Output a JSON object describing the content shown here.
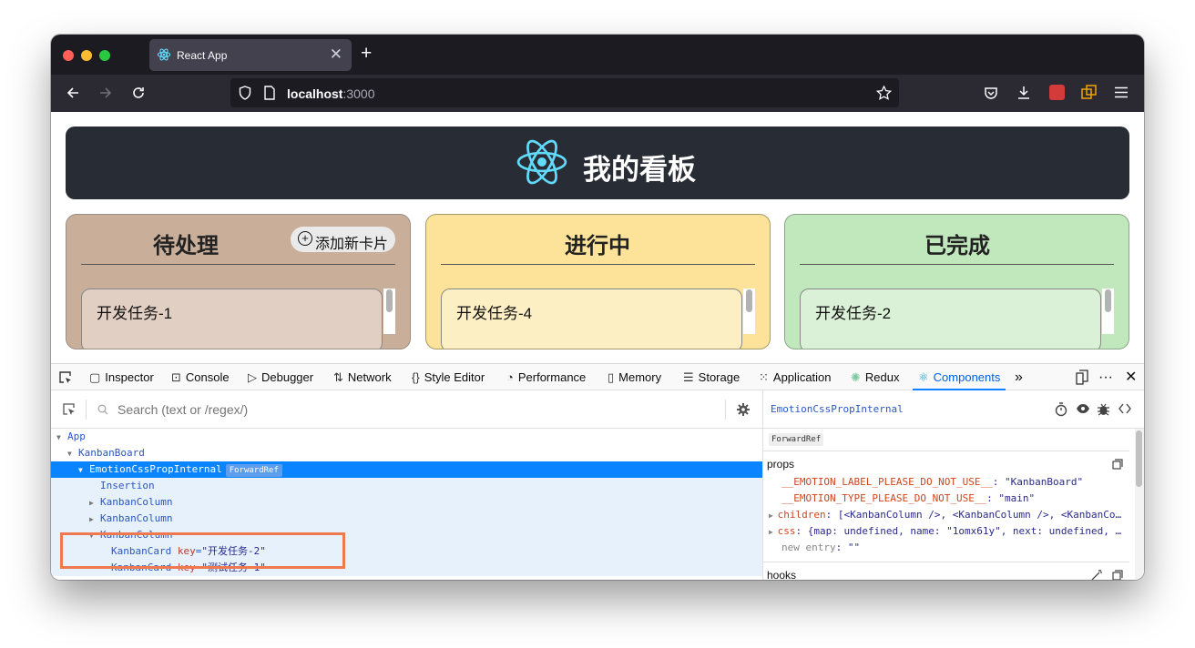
{
  "browser": {
    "tab_title": "React App",
    "tab_close": "✕",
    "new_tab": "+",
    "url_host": "localhost",
    "url_port": ":3000"
  },
  "app": {
    "title": "我的看板",
    "columns": [
      {
        "title": "待处理",
        "bg": "#c9af9a",
        "card_bg": "#e1cfc3",
        "add_label": "添加新卡片",
        "first_card": "开发任务-1"
      },
      {
        "title": "进行中",
        "bg": "#fde39a",
        "card_bg": "#fdefc4",
        "first_card": "开发任务-4"
      },
      {
        "title": "已完成",
        "bg": "#c1e7bc",
        "card_bg": "#dbf1d7",
        "first_card": "开发任务-2"
      }
    ]
  },
  "devtools": {
    "tabs": [
      "Inspector",
      "Console",
      "Debugger",
      "Network",
      "Style Editor",
      "Performance",
      "Memory",
      "Storage",
      "Application",
      "Redux",
      "Components"
    ],
    "active_tab": "Components",
    "search_placeholder": "Search (text or /regex/)",
    "tree": [
      {
        "name": "App"
      },
      {
        "name": "KanbanBoard"
      },
      {
        "name": "EmotionCssPropInternal",
        "badge": "ForwardRef"
      },
      {
        "name": "Insertion"
      },
      {
        "name": "KanbanColumn"
      },
      {
        "name": "KanbanColumn"
      },
      {
        "name": "KanbanColumn"
      },
      {
        "name": "KanbanCard",
        "key": "key",
        "value": "\"开发任务-2\""
      },
      {
        "name": "KanbanCard",
        "key": "key",
        "value": "\"测试任务-1\""
      }
    ],
    "inspector": {
      "component": "EmotionCssPropInternal",
      "badge": "ForwardRef",
      "props_label": "props",
      "hooks_label": "hooks",
      "props": [
        {
          "key": "__EMOTION_LABEL_PLEASE_DO_NOT_USE__",
          "value": "\"KanbanBoard\""
        },
        {
          "key": "__EMOTION_TYPE_PLEASE_DO_NOT_USE__",
          "value": "\"main\""
        },
        {
          "key": "children",
          "value": "[<KanbanColumn />, <KanbanColumn />, <KanbanCo…"
        },
        {
          "key": "css",
          "value": "{map: undefined, name: \"1omx61y\", next: undefined, …"
        },
        {
          "key": "new entry",
          "value": "\"\""
        }
      ]
    }
  }
}
